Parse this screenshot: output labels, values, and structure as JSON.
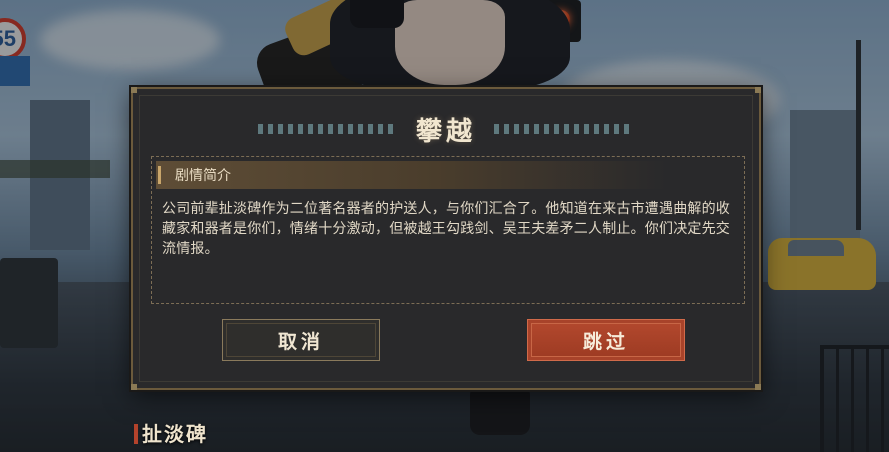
{
  "dialog": {
    "title": "攀越",
    "section_label": "剧情简介",
    "synopsis": "公司前辈扯淡碑作为二位著名器者的护送人，与你们汇合了。他知道在来古市遭遇曲解的收藏家和器者是你们，情绪十分激动，但被越王勾践剑、吴王夫差矛二人制止。你们决定先交流情报。",
    "cancel_label": "取消",
    "skip_label": "跳过"
  },
  "speaker": {
    "name": "扯淡碑"
  },
  "scene": {
    "speed_sign": "55"
  },
  "colors": {
    "dialog_bg": "#29292b",
    "gold_border": "#6b5a3c",
    "skip_button": "#b4492e",
    "title_text": "#f1e6cf"
  }
}
